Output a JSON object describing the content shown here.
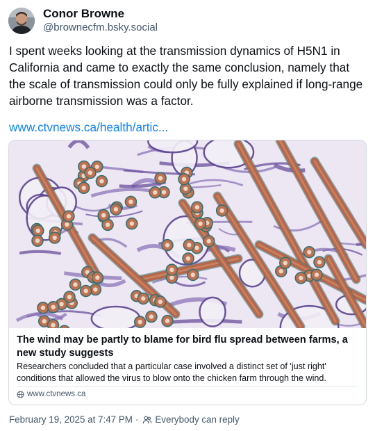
{
  "author": {
    "display_name": "Conor Browne",
    "handle": "@brownecfm.bsky.social"
  },
  "post": {
    "text": "I spent weeks looking at the transmission dynamics of H5N1 in California and came to exactly the same conclusion, namely that the scale of transmission could only be fully explained if long-range airborne transmission was a factor.",
    "link": "www.ctvnews.ca/health/artic..."
  },
  "embed": {
    "image_icon": "virus-micrograph-image",
    "title": "The wind may be partly to blame for bird flu spread between farms, a new study suggests",
    "description": "Researchers concluded that a particular case involved a distinct set of 'just right' conditions that allowed the virus to blow onto the chicken farm through the wind.",
    "domain": "www.ctvnews.ca",
    "domain_icon": "globe-icon"
  },
  "meta": {
    "timestamp": "February 19, 2025 at 7:47 PM",
    "separator": "·",
    "reply_setting": "Everybody can reply",
    "reply_icon": "people-icon"
  },
  "colors": {
    "link": "#1083fe",
    "muted": "#42576c",
    "border": "#d4dbe2"
  }
}
